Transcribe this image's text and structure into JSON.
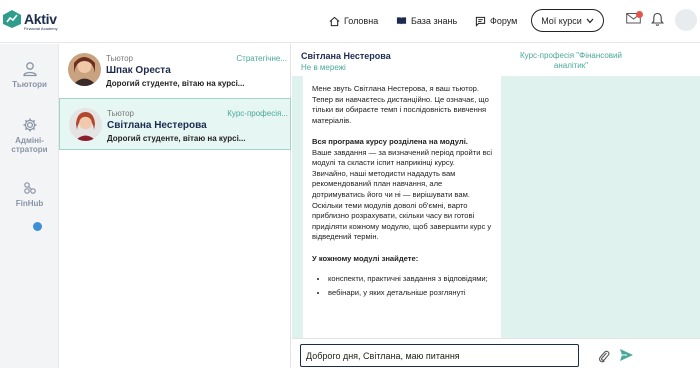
{
  "app": {
    "logo_name": "Aktiv",
    "logo_sub": "Financial Academy"
  },
  "nav": {
    "home": "Головна",
    "knowledge_base": "База знань",
    "forum": "Форум",
    "my_courses": "Мої курси"
  },
  "sidebar": {
    "items": [
      {
        "label": "Тьютори",
        "icon": "user-icon"
      },
      {
        "label": "Адміні-\nстратори",
        "icon": "gear-icon"
      },
      {
        "label": "FinHub",
        "icon": "finhub-icon"
      }
    ]
  },
  "conversations": [
    {
      "role": "Тьютор",
      "course": "Стратегічне...",
      "name": "Шпак Ореста",
      "preview": "Дорогий студенте, вітаю на курсі...",
      "selected": false
    },
    {
      "role": "Тьютор",
      "course": "Курс-професія...",
      "name": "Світлана Нестерова",
      "preview": "Дорогий студенте, вітаю на курсі...",
      "selected": true
    }
  ],
  "chat": {
    "name": "Світлана Нестерова",
    "status": "Не в мережі",
    "course": "Курс-професія \"Фінансовий аналітик\"",
    "message": {
      "p1": "Мене звуть Світлана Нестерова, я ваш тьютор.",
      "p2": "Тепер ви навчаєтесь дистанційно. Це означає, що тільки ви обираєте темп і послідовність вивчення матеріалів.",
      "p3_bold": "Вся програма курсу розділена на модулі.",
      "p4": "Ваше завдання — за визначений період пройти всі модулі та скласти іспит наприкінці курсу.",
      "p5": "Звичайно, наші методисти нададуть вам рекомендований план навчання, але дотримуватись його чи ні — вирішувати вам.",
      "p6": "Оскільки теми модулів доволі об'ємні, варто приблизно розрахувати, скільки часу ви готові приділяти кожному модулю, щоб завершити курс у відведений термін.",
      "p7_bold": "У кожному модулі знайдете:",
      "bullets": [
        "конспекти, практичні завдання з відповідями;",
        "вебінари, у яких детальніше розглянуті"
      ]
    },
    "input_value": "Доброго дня, Світлана, маю питання"
  },
  "colors": {
    "accent": "#4aa89a",
    "chat_bg": "#dff2ee",
    "selected_bg": "#e6f6f3",
    "navy": "#1d2b4f",
    "notification": "#e2564b"
  }
}
